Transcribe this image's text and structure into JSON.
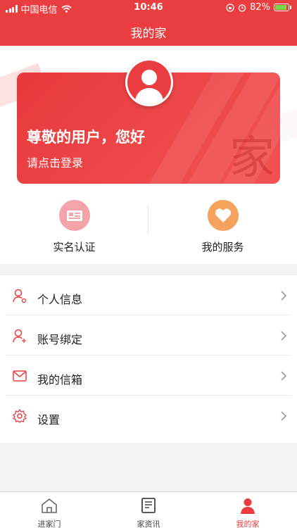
{
  "status": {
    "carrier": "中国电信",
    "time": "10:46",
    "battery": "82%"
  },
  "header": {
    "title": "我的家"
  },
  "profile": {
    "greeting": "尊敬的用户，您好",
    "login_prompt": "请点击登录",
    "watermark": "家"
  },
  "quick_actions": [
    {
      "label": "实名认证",
      "icon": "id-card-icon"
    },
    {
      "label": "我的服务",
      "icon": "heart-icon"
    }
  ],
  "menu": [
    {
      "label": "个人信息",
      "icon": "user-info-icon"
    },
    {
      "label": "账号绑定",
      "icon": "account-link-icon"
    },
    {
      "label": "我的信箱",
      "icon": "mail-icon"
    },
    {
      "label": "设置",
      "icon": "gear-icon"
    }
  ],
  "tabs": [
    {
      "label": "进家门",
      "icon": "home-icon"
    },
    {
      "label": "家资讯",
      "icon": "news-icon"
    },
    {
      "label": "我的家",
      "icon": "profile-icon",
      "active": true
    }
  ],
  "colors": {
    "accent": "#ea3d3f",
    "battery": "#7ad94a"
  }
}
